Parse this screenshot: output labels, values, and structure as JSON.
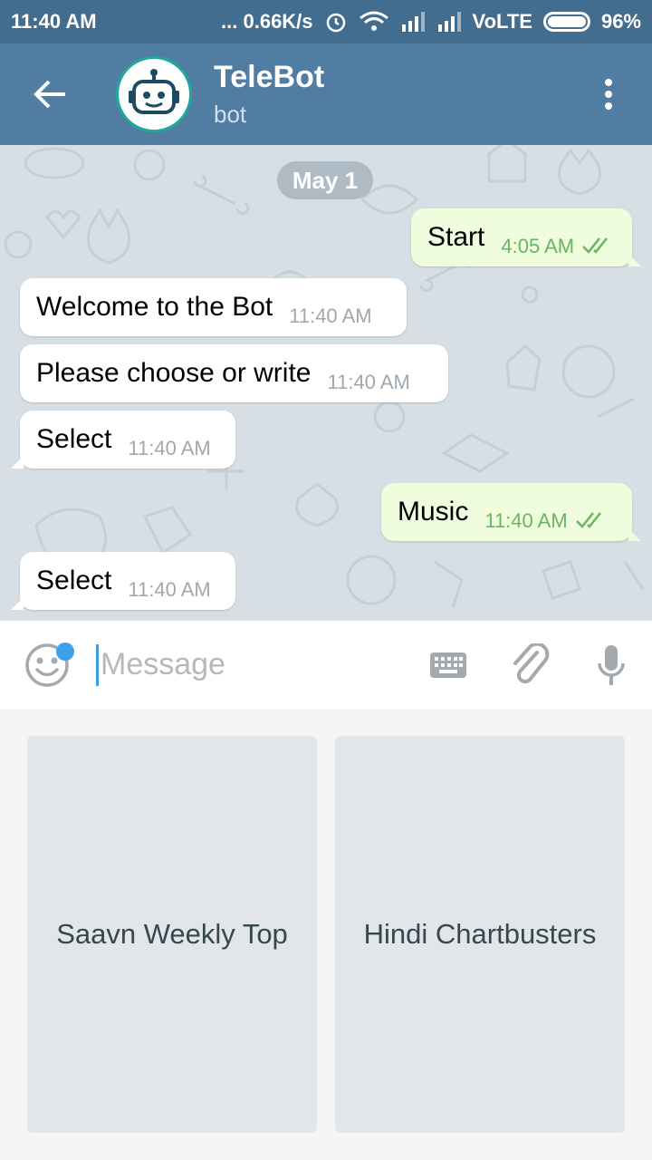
{
  "status_bar": {
    "time": "11:40 AM",
    "net_speed": "... 0.66K/s",
    "network": "VoLTE",
    "battery": "96%"
  },
  "header": {
    "title": "TeleBot",
    "subtitle": "bot"
  },
  "chat": {
    "date": "May 1",
    "messages": [
      {
        "dir": "out",
        "text": "Start",
        "time": "4:05 AM"
      },
      {
        "dir": "in",
        "text": "Welcome to the Bot",
        "time": "11:40 AM"
      },
      {
        "dir": "in",
        "text": "Please choose or write",
        "time": "11:40 AM"
      },
      {
        "dir": "in",
        "text": "Select",
        "time": "11:40 AM"
      },
      {
        "dir": "out",
        "text": "Music",
        "time": "11:40 AM"
      },
      {
        "dir": "in",
        "text": "Select",
        "time": "11:40 AM"
      }
    ]
  },
  "input": {
    "placeholder": "Message"
  },
  "keyboard": {
    "buttons": [
      "Saavn Weekly Top",
      "Hindi Chartbusters"
    ]
  },
  "colors": {
    "status_bar": "#436d8f",
    "app_bar": "#517da2",
    "outgoing_bubble": "#effdde",
    "read_tick": "#6bb461"
  }
}
